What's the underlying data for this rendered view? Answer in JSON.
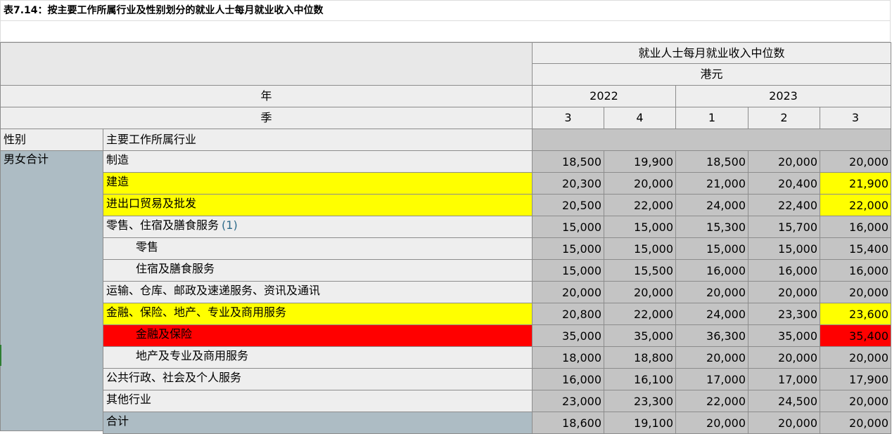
{
  "title": "表7.14：按主要工作所属行业及性别划分的就业人士每月就业收入中位数",
  "header": {
    "measure": "就业人士每月就业收入中位数",
    "unit": "港元",
    "year_label": "年",
    "quarter_label": "季",
    "years": [
      "2022",
      "2023"
    ],
    "quarters": [
      "3",
      "4",
      "1",
      "2",
      "3"
    ],
    "col_sex": "性别",
    "col_industry": "主要工作所属行业"
  },
  "sex_group": "男女合计",
  "rows": [
    {
      "label": "制造",
      "values": [
        "18,500",
        "19,900",
        "18,500",
        "20,000",
        "20,000"
      ]
    },
    {
      "label": "建造",
      "values": [
        "20,300",
        "20,000",
        "21,000",
        "20,400",
        "21,900"
      ]
    },
    {
      "label": "进出口贸易及批发",
      "values": [
        "20,500",
        "22,000",
        "24,000",
        "22,400",
        "22,000"
      ]
    },
    {
      "label": "零售、住宿及膳食服务",
      "note": "(1)",
      "values": [
        "15,000",
        "15,000",
        "15,300",
        "15,700",
        "16,000"
      ]
    },
    {
      "label": "零售",
      "values": [
        "15,000",
        "15,000",
        "15,000",
        "15,000",
        "15,400"
      ]
    },
    {
      "label": "住宿及膳食服务",
      "values": [
        "15,000",
        "15,500",
        "16,000",
        "16,000",
        "16,000"
      ]
    },
    {
      "label": "运输、仓库、邮政及速递服务、资讯及通讯",
      "values": [
        "20,000",
        "20,000",
        "20,000",
        "20,000",
        "20,000"
      ]
    },
    {
      "label": "金融、保险、地产、专业及商用服务",
      "values": [
        "20,800",
        "22,000",
        "24,000",
        "23,300",
        "23,600"
      ]
    },
    {
      "label": "金融及保险",
      "values": [
        "35,000",
        "35,000",
        "36,300",
        "35,000",
        "35,400"
      ]
    },
    {
      "label": "地产及专业及商用服务",
      "values": [
        "18,000",
        "18,800",
        "20,000",
        "20,000",
        "20,000"
      ]
    },
    {
      "label": "公共行政、社会及个人服务",
      "values": [
        "16,000",
        "16,100",
        "17,000",
        "17,000",
        "17,900"
      ]
    },
    {
      "label": "其他行业",
      "values": [
        "23,000",
        "23,300",
        "22,000",
        "24,500",
        "20,000"
      ]
    },
    {
      "label": "合计",
      "values": [
        "18,600",
        "19,100",
        "20,000",
        "20,000",
        "20,000"
      ]
    }
  ],
  "colors": {
    "yellow": "#ffff00",
    "red": "#ff0000",
    "grey": "#c4c4c4",
    "sex_col": "#adbcc4"
  }
}
